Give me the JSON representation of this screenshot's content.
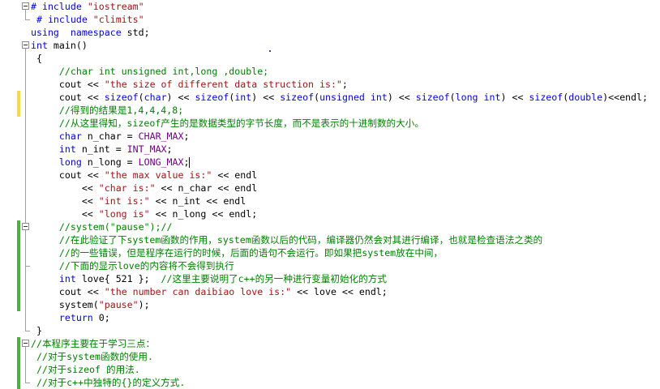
{
  "editor": {
    "lines": [
      {
        "code": [
          {
            "t": "kw",
            "v": "# include "
          },
          {
            "t": "str",
            "v": "\"iostream\""
          }
        ]
      },
      {
        "code": [
          {
            "t": "kw",
            "v": " # include "
          },
          {
            "t": "str",
            "v": "\"climits\""
          }
        ]
      },
      {
        "code": [
          {
            "t": "kw",
            "v": "using  namespace"
          },
          {
            "t": "tx",
            "v": " std;"
          }
        ]
      },
      {
        "code": [
          {
            "t": "kw",
            "v": "int"
          },
          {
            "t": "tx",
            "v": " main()"
          }
        ]
      },
      {
        "code": [
          {
            "t": "tx",
            "v": " {"
          }
        ]
      },
      {
        "code": [
          {
            "t": "cm",
            "v": "     //char int unsigned int,long ,double;"
          }
        ]
      },
      {
        "code": [
          {
            "t": "tx",
            "v": "     cout << "
          },
          {
            "t": "str",
            "v": "\"the size of different data struction is:\""
          },
          {
            "t": "tx",
            "v": ";"
          }
        ]
      },
      {
        "code": [
          {
            "t": "tx",
            "v": "     cout << "
          },
          {
            "t": "kw",
            "v": "sizeof"
          },
          {
            "t": "tx",
            "v": "("
          },
          {
            "t": "kw",
            "v": "char"
          },
          {
            "t": "tx",
            "v": ") << "
          },
          {
            "t": "kw",
            "v": "sizeof"
          },
          {
            "t": "tx",
            "v": "("
          },
          {
            "t": "kw",
            "v": "int"
          },
          {
            "t": "tx",
            "v": ") << "
          },
          {
            "t": "kw",
            "v": "sizeof"
          },
          {
            "t": "tx",
            "v": "("
          },
          {
            "t": "kw",
            "v": "unsigned int"
          },
          {
            "t": "tx",
            "v": ") << "
          },
          {
            "t": "kw",
            "v": "sizeof"
          },
          {
            "t": "tx",
            "v": "("
          },
          {
            "t": "kw",
            "v": "long int"
          },
          {
            "t": "tx",
            "v": ") << "
          },
          {
            "t": "kw",
            "v": "sizeof"
          },
          {
            "t": "tx",
            "v": "("
          },
          {
            "t": "kw",
            "v": "double"
          },
          {
            "t": "tx",
            "v": ")<<endl;"
          }
        ]
      },
      {
        "code": [
          {
            "t": "cm",
            "v": "     //得到的结果是1,4,4,4,8;"
          }
        ]
      },
      {
        "code": [
          {
            "t": "cm",
            "v": "     //从这里得知，sizeof产生的是数据类型的字节长度，而不是表示的十进制数的大小。"
          }
        ]
      },
      {
        "code": [
          {
            "t": "kw",
            "v": "     char"
          },
          {
            "t": "tx",
            "v": " n_char = "
          },
          {
            "t": "mac",
            "v": "CHAR_MAX"
          },
          {
            "t": "tx",
            "v": ";"
          }
        ]
      },
      {
        "code": [
          {
            "t": "kw",
            "v": "     int"
          },
          {
            "t": "tx",
            "v": " n_int = "
          },
          {
            "t": "mac",
            "v": "INT_MAX"
          },
          {
            "t": "tx",
            "v": ";"
          }
        ]
      },
      {
        "code": [
          {
            "t": "kw",
            "v": "     long"
          },
          {
            "t": "tx",
            "v": " n_long = "
          },
          {
            "t": "mac",
            "v": "LONG_MAX"
          },
          {
            "t": "tx",
            "v": ";"
          },
          {
            "t": "cursor",
            "v": ""
          }
        ]
      },
      {
        "code": [
          {
            "t": "tx",
            "v": "     cout << "
          },
          {
            "t": "str",
            "v": "\"the max value is:\""
          },
          {
            "t": "tx",
            "v": " << endl"
          }
        ]
      },
      {
        "code": [
          {
            "t": "tx",
            "v": "         << "
          },
          {
            "t": "str",
            "v": "\"char is:\""
          },
          {
            "t": "tx",
            "v": " << n_char << endl"
          }
        ]
      },
      {
        "code": [
          {
            "t": "tx",
            "v": "         << "
          },
          {
            "t": "str",
            "v": "\"int is:\""
          },
          {
            "t": "tx",
            "v": " << n_int << endl"
          }
        ]
      },
      {
        "code": [
          {
            "t": "tx",
            "v": "         << "
          },
          {
            "t": "str",
            "v": "\"long is\""
          },
          {
            "t": "tx",
            "v": " << n_long << endl;"
          }
        ]
      },
      {
        "code": [
          {
            "t": "cm",
            "v": "     //system(\"pause\");//"
          }
        ]
      },
      {
        "code": [
          {
            "t": "cm",
            "v": "     //在此验证了下system函数的作用，system函数以后的代码，编译器仍然会对其进行编译，也就是检查语法之类的"
          }
        ]
      },
      {
        "code": [
          {
            "t": "cm",
            "v": "     //的一些错误，但是程序在运行的时候，后面的语句不会运行。即如果把system放在中间，"
          }
        ]
      },
      {
        "code": [
          {
            "t": "cm",
            "v": "     //下面的显示love的内容将不会得到执行"
          }
        ]
      },
      {
        "code": [
          {
            "t": "kw",
            "v": "     int"
          },
          {
            "t": "tx",
            "v": " love{ 521 };  "
          },
          {
            "t": "cm",
            "v": "//这里主要说明了c++的另一种进行变量初始化的方式"
          }
        ]
      },
      {
        "code": [
          {
            "t": "tx",
            "v": "     cout << "
          },
          {
            "t": "str",
            "v": "\"the number can daibiao love is:\""
          },
          {
            "t": "tx",
            "v": " << love << endl;"
          }
        ]
      },
      {
        "code": [
          {
            "t": "tx",
            "v": "     system("
          },
          {
            "t": "str",
            "v": "\"pause\""
          },
          {
            "t": "tx",
            "v": ");"
          }
        ]
      },
      {
        "code": [
          {
            "t": "kw",
            "v": "     return"
          },
          {
            "t": "tx",
            "v": " 0;"
          }
        ]
      },
      {
        "code": [
          {
            "t": "tx",
            "v": " }"
          }
        ]
      },
      {
        "code": [
          {
            "t": "cm",
            "v": "//本程序主要在于学习三点："
          }
        ]
      },
      {
        "code": [
          {
            "t": "cm",
            "v": " //对于system函数的使用."
          }
        ]
      },
      {
        "code": [
          {
            "t": "cm",
            "v": " //对于sizeof 的用法."
          }
        ]
      },
      {
        "code": [
          {
            "t": "cm",
            "v": " //对于c++中独特的{}的定义方式."
          }
        ]
      }
    ],
    "margin_marks": [
      {
        "line": 7,
        "color": "yellow"
      },
      {
        "line": 8,
        "color": "yellow"
      },
      {
        "line": 17,
        "color": "green"
      },
      {
        "line": 18,
        "color": "green"
      },
      {
        "line": 19,
        "color": "green"
      },
      {
        "line": 20,
        "color": "green"
      },
      {
        "line": 21,
        "color": "green"
      },
      {
        "line": 22,
        "color": "green"
      },
      {
        "line": 23,
        "color": "green"
      },
      {
        "line": 26,
        "color": "green"
      },
      {
        "line": 27,
        "color": "green"
      },
      {
        "line": 28,
        "color": "green"
      },
      {
        "line": 29,
        "color": "green"
      }
    ],
    "colors": {
      "keyword": "#0000ff",
      "string": "#a31515",
      "comment": "#008000",
      "macro": "#6f008a",
      "yellow_mark": "#f4dd3a",
      "green_mark": "#45b438"
    }
  }
}
